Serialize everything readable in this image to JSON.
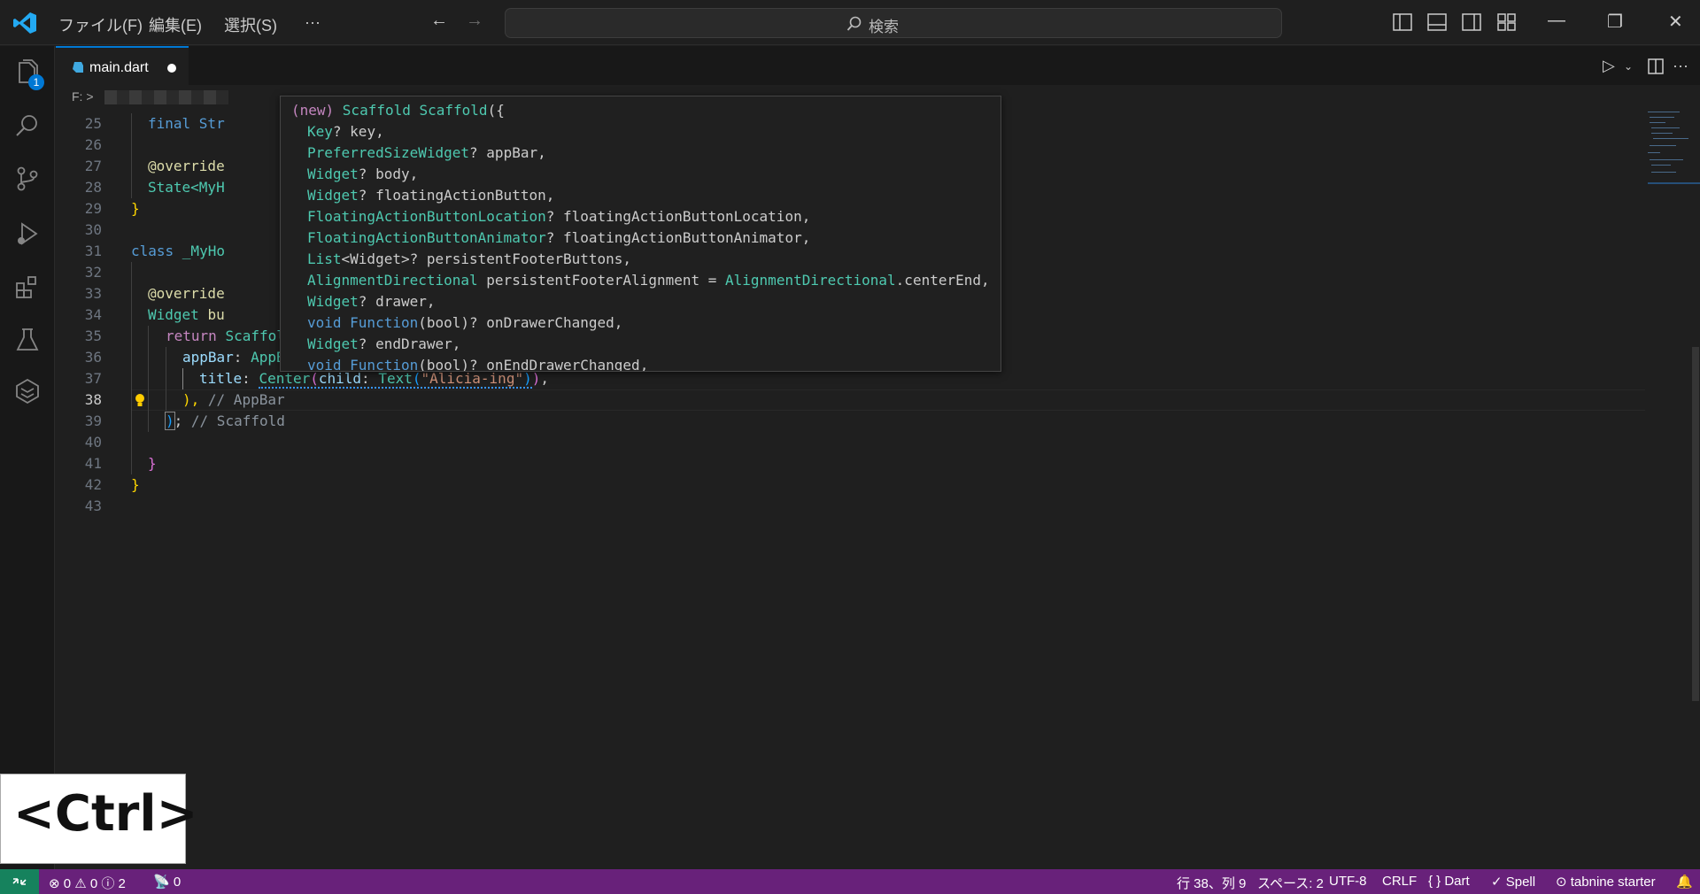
{
  "titlebar": {
    "menu": [
      "ファイル(F)",
      "編集(E)",
      "選択(S)",
      "···"
    ],
    "search_label": "検索"
  },
  "activity_badge": "1",
  "tab": {
    "name": "main.dart"
  },
  "breadcrumb": {
    "drive": "F: >"
  },
  "code_lines": [
    {
      "n": "25"
    },
    {
      "n": "26"
    },
    {
      "n": "27"
    },
    {
      "n": "28"
    },
    {
      "n": "29"
    },
    {
      "n": "30"
    },
    {
      "n": "31"
    },
    {
      "n": "32"
    },
    {
      "n": "33"
    },
    {
      "n": "34"
    },
    {
      "n": "35"
    },
    {
      "n": "36"
    },
    {
      "n": "37"
    },
    {
      "n": "38"
    },
    {
      "n": "39"
    },
    {
      "n": "40"
    },
    {
      "n": "41"
    },
    {
      "n": "42"
    },
    {
      "n": "43"
    }
  ],
  "code": {
    "l25": "final Str",
    "l27": "@override",
    "l28a": "State<",
    "l28b": "MyH",
    "l29": "}",
    "l31a": "class ",
    "l31b": "_MyHo",
    "l33": "@override",
    "l34a": "Widget ",
    "l34b": "bu",
    "l35a": "return ",
    "l35b": "Scaffold",
    "l35c": "(",
    "l36a": "appBar",
    "l36b": ": ",
    "l36c": "AppBar",
    "l36d": "(",
    "l37a": "title",
    "l37b": ": ",
    "l37c": "Center",
    "l37d": "(",
    "l37e": "child",
    "l37f": ": ",
    "l37g": "Text",
    "l37h": "(",
    "l37i": "\"Alicia-ing\"",
    "l37j": ")",
    "l37k": ")",
    "l37l": ",",
    "l38a": "), ",
    "l38b": "// AppBar",
    "l39a": ")",
    "l39b": "; ",
    "l39c": "// Scaffold",
    "l41": "}",
    "l42": "}"
  },
  "hover": {
    "h0a": "(new) ",
    "h0b": "Scaffold ",
    "h0c": "Scaffold",
    "h0d": "({",
    "lines": [
      {
        "type": "Key",
        "rest": "? key,"
      },
      {
        "type": "PreferredSizeWidget",
        "rest": "? appBar,"
      },
      {
        "type": "Widget",
        "rest": "? body,"
      },
      {
        "type": "Widget",
        "rest": "? floatingActionButton,"
      },
      {
        "type": "FloatingActionButtonLocation",
        "rest": "? floatingActionButtonLocation,"
      },
      {
        "type": "FloatingActionButtonAnimator",
        "rest": "? floatingActionButtonAnimator,"
      },
      {
        "type": "List",
        "rest": "<Widget>? persistentFooterButtons,"
      },
      {
        "type": "AlignmentDirectional",
        "rest": " persistentFooterAlignment = ",
        "type2": "AlignmentDirectional",
        "rest2": ".centerEnd,"
      },
      {
        "type": "Widget",
        "rest": "? drawer,"
      },
      {
        "type": "void Function",
        "rest": "(bool)? onDrawerChanged,"
      },
      {
        "type": "Widget",
        "rest": "? endDrawer,"
      },
      {
        "type": "void Function",
        "rest": "(bool)? onEndDrawerChanged,"
      }
    ]
  },
  "overlay": {
    "text": "<Ctrl>"
  },
  "status": {
    "problems": "⊗ 0 ⚠ 0 ⓘ 2",
    "ports": "0",
    "position": "行 38、列 9",
    "spaces": "スペース: 2",
    "encoding": "UTF-8",
    "eol": "CRLF",
    "language": "{ } Dart",
    "spell": "✓ Spell",
    "tabnine": "tabnine starter"
  },
  "colors": {
    "accent": "#0078d4",
    "statusbar": "#68217a",
    "remote": "#16825d"
  }
}
